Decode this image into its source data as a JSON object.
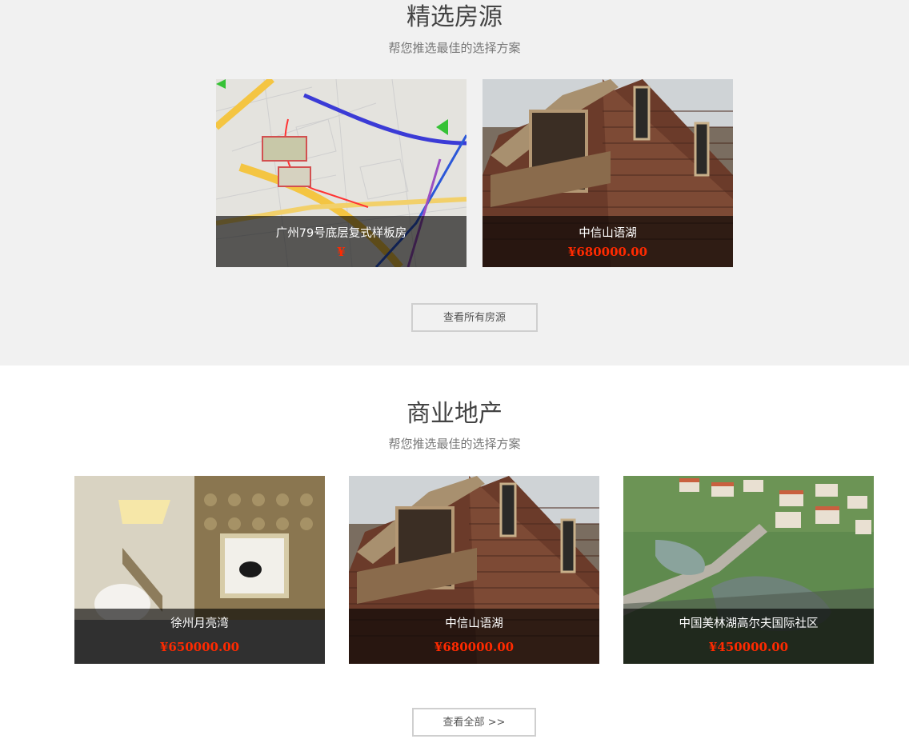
{
  "featured": {
    "title": "精选房源",
    "subtitle": "帮您推选最佳的选择方案",
    "cards": [
      {
        "name": "广州79号底层复式样板房",
        "price": "¥",
        "image": "map-image"
      },
      {
        "name": "中信山语湖",
        "price": "¥680000.00",
        "image": "brick-house-image"
      }
    ],
    "more_label": "查看所有房源"
  },
  "commercial": {
    "title": "商业地产",
    "subtitle": "帮您推选最佳的选择方案",
    "cards": [
      {
        "name": "徐州月亮湾",
        "price": "¥650000.00",
        "image": "interior-image"
      },
      {
        "name": "中信山语湖",
        "price": "¥680000.00",
        "image": "brick-house-image"
      },
      {
        "name": "中国美林湖高尔夫国际社区",
        "price": "¥450000.00",
        "image": "aerial-community-image"
      }
    ],
    "more_label": "查看全部 >>"
  },
  "colors": {
    "price": "#ff2a00",
    "featured_bg": "#f1f1f1",
    "overlay": "rgba(0,0,0,0.62)"
  }
}
